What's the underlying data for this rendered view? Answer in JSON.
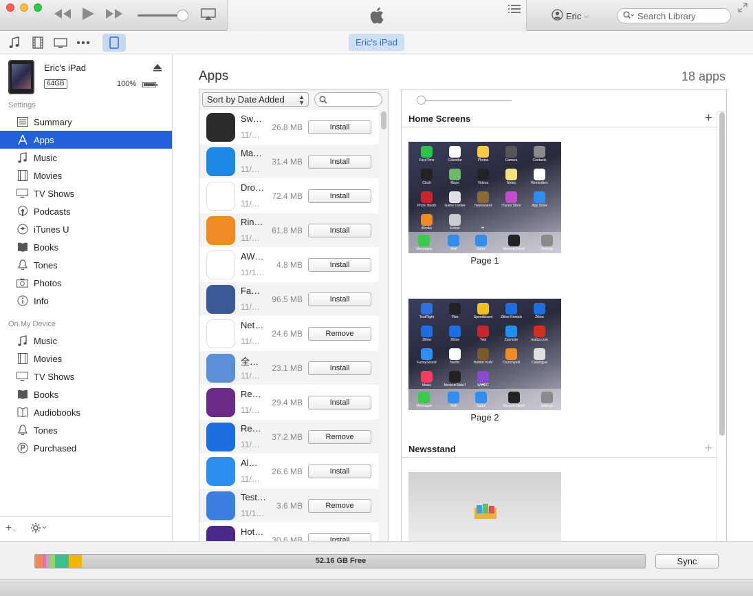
{
  "titlebar": {
    "account_name": "Eric",
    "search_placeholder": "Search Library"
  },
  "toolbar": {
    "device_pill": "Eric's iPad"
  },
  "device": {
    "name": "Eric's iPad",
    "capacity": "64GB",
    "battery": "100%"
  },
  "sidebar": {
    "settings_header": "Settings",
    "settings_items": [
      {
        "label": "Summary",
        "icon": "summary-icon"
      },
      {
        "label": "Apps",
        "icon": "apps-icon"
      },
      {
        "label": "Music",
        "icon": "music-note-icon"
      },
      {
        "label": "Movies",
        "icon": "film-icon"
      },
      {
        "label": "TV Shows",
        "icon": "tv-icon"
      },
      {
        "label": "Podcasts",
        "icon": "podcast-icon"
      },
      {
        "label": "iTunes U",
        "icon": "graduation-cap-icon"
      },
      {
        "label": "Books",
        "icon": "book-icon"
      },
      {
        "label": "Tones",
        "icon": "bell-icon"
      },
      {
        "label": "Photos",
        "icon": "camera-icon"
      },
      {
        "label": "Info",
        "icon": "info-icon"
      }
    ],
    "device_header": "On My Device",
    "device_items": [
      {
        "label": "Music",
        "icon": "music-note-icon"
      },
      {
        "label": "Movies",
        "icon": "film-icon"
      },
      {
        "label": "TV Shows",
        "icon": "tv-icon"
      },
      {
        "label": "Books",
        "icon": "book-icon"
      },
      {
        "label": "Audiobooks",
        "icon": "audiobook-icon"
      },
      {
        "label": "Tones",
        "icon": "bell-icon"
      },
      {
        "label": "Purchased",
        "icon": "purchased-icon"
      }
    ]
  },
  "main": {
    "title": "Apps",
    "count": "18 apps",
    "sort_label": "Sort by Date Added",
    "apps": [
      {
        "name": "Sw…",
        "date": "11/…",
        "size": "26.8 MB",
        "action": "Install",
        "color": "#2b2b2b"
      },
      {
        "name": "Ma…",
        "date": "11/…",
        "size": "31.4 MB",
        "action": "Install",
        "color": "#1e88e5"
      },
      {
        "name": "Dro…",
        "date": "11/…",
        "size": "72.4 MB",
        "action": "Install",
        "color": "#ffffff"
      },
      {
        "name": "Rin…",
        "date": "11/…",
        "size": "61.8 MB",
        "action": "Install",
        "color": "#f08a24"
      },
      {
        "name": "AW…",
        "date": "11/1…",
        "size": "4.8 MB",
        "action": "Install",
        "color": "#ffffff"
      },
      {
        "name": "Fa…",
        "date": "11/…",
        "size": "96.5 MB",
        "action": "Install",
        "color": "#3b5998"
      },
      {
        "name": "Net…",
        "date": "11/…",
        "size": "24.6 MB",
        "action": "Remove",
        "color": "#ffffff"
      },
      {
        "name": "全…",
        "date": "11/…",
        "size": "23.1 MB",
        "action": "Install",
        "color": "#5b8fd6"
      },
      {
        "name": "Re…",
        "date": "11/…",
        "size": "29.4 MB",
        "action": "Install",
        "color": "#6a2a8a"
      },
      {
        "name": "Re…",
        "date": "11/…",
        "size": "37.2 MB",
        "action": "Remove",
        "color": "#1d6fe0"
      },
      {
        "name": "Al…",
        "date": "11/…",
        "size": "26.6 MB",
        "action": "Install",
        "color": "#2c8ff0"
      },
      {
        "name": "Test…",
        "date": "11/1…",
        "size": "3.6 MB",
        "action": "Remove",
        "color": "#3d7fe0"
      },
      {
        "name": "Hot…",
        "date": "",
        "size": "30.6 MB",
        "action": "Install",
        "color": "#4a2a88"
      }
    ],
    "home_screens_header": "Home Screens",
    "page1_label": "Page 1",
    "page2_label": "Page 2",
    "newsstand_header": "Newsstand",
    "page1_apps": [
      "FaceTime",
      "Calendar",
      "Photos",
      "Camera",
      "Contacts",
      "Clock",
      "Maps",
      "Videos",
      "Notes",
      "Reminders",
      "Photo Booth",
      "Game Center",
      "Newsstand",
      "iTunes Store",
      "App Store",
      "iBooks",
      "Extras"
    ],
    "page1_colors": [
      "#2fc24a",
      "#ffffff",
      "#f7c948",
      "#555555",
      "#8a8a8a",
      "#222222",
      "#6fb86a",
      "#222222",
      "#f6e27a",
      "#ffffff",
      "#c0282d",
      "#e0e0e0",
      "#8a6a3a",
      "#c04ec8",
      "#2f8ef0",
      "#f08a24",
      "#cccccc"
    ],
    "page2_apps": [
      "TestFlight",
      "Plex",
      "Speedboard",
      "Zillow Rentals",
      "Zillow",
      "Zillow",
      "Zillow",
      "Yelp",
      "Zaxmote",
      "realtor.com",
      "FunnySound",
      "Netflix",
      "Hobbit: KoM",
      "Crunchyroll",
      "Catalogue",
      "Music",
      "Movie★Slate7",
      "WWDC"
    ],
    "page2_colors": [
      "#2f6fe0",
      "#222222",
      "#f0c020",
      "#1d6fe0",
      "#1d6fe0",
      "#1d6fe0",
      "#1d6fe0",
      "#c0282d",
      "#2090f0",
      "#d03020",
      "#2f8ef0",
      "#ffffff",
      "#7a5a2a",
      "#f08a24",
      "#e0e0e0",
      "#f04060",
      "#222222",
      "#8a4ad0"
    ],
    "dock_apps": [
      "Messages",
      "Mail",
      "Safari",
      "Movie★Slate8",
      "Settings"
    ],
    "dock_colors": [
      "#3cc84a",
      "#2f8ef0",
      "#2f8ef0",
      "#222222",
      "#8a8a8a"
    ]
  },
  "storage": {
    "free_label": "52.16 GB Free",
    "sync_label": "Sync",
    "segments": [
      {
        "color": "#f08a5a",
        "fraction": 0.012
      },
      {
        "color": "#e870a0",
        "fraction": 0.006
      },
      {
        "color": "#c0a0e0",
        "fraction": 0.006
      },
      {
        "color": "#a0d060",
        "fraction": 0.009
      },
      {
        "color": "#40c090",
        "fraction": 0.022
      },
      {
        "color": "#f0b800",
        "fraction": 0.021
      }
    ]
  }
}
